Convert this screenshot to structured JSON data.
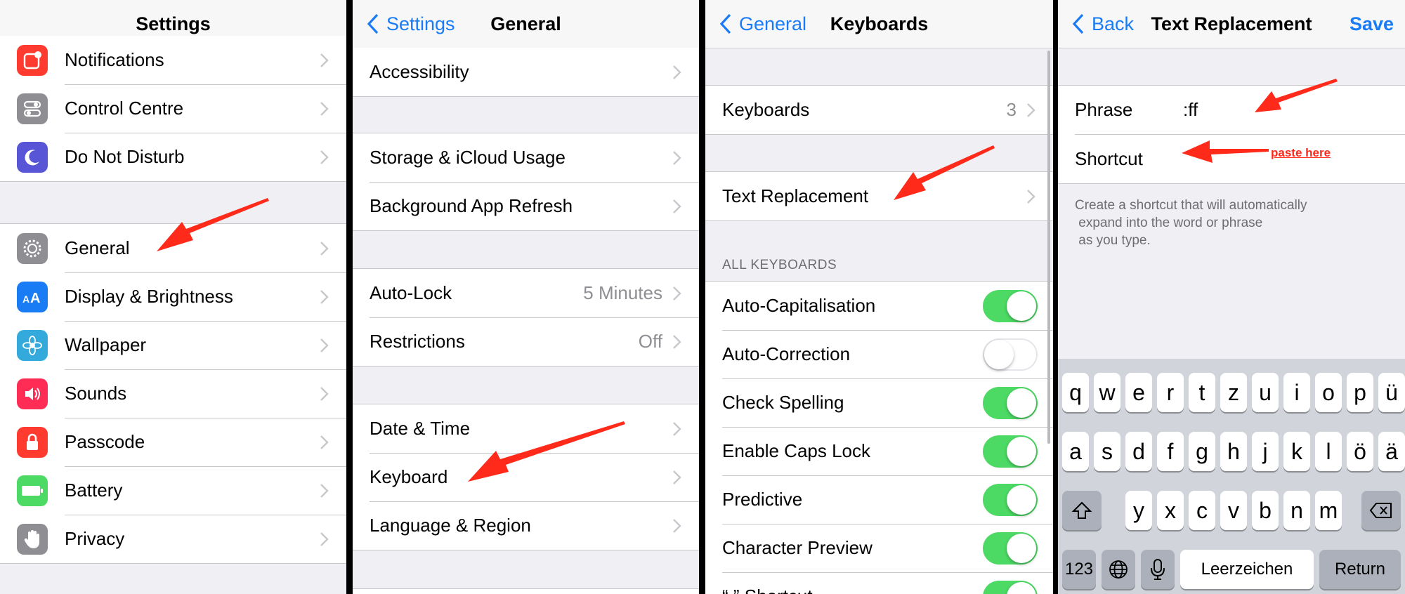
{
  "panel1": {
    "title": "Settings",
    "rows_top": [
      {
        "label": "Notifications",
        "icon": "notifications-icon",
        "color": "#ff3b30"
      },
      {
        "label": "Control Centre",
        "icon": "control-centre-icon",
        "color": "#8e8e93"
      },
      {
        "label": "Do Not Disturb",
        "icon": "moon-icon",
        "color": "#5856d6"
      }
    ],
    "rows_bottom": [
      {
        "label": "General",
        "icon": "gear-icon",
        "color": "#8e8e93"
      },
      {
        "label": "Display & Brightness",
        "icon": "text-size-icon",
        "color": "#1a7cf5"
      },
      {
        "label": "Wallpaper",
        "icon": "flower-icon",
        "color": "#34aadc"
      },
      {
        "label": "Sounds",
        "icon": "speaker-icon",
        "color": "#ff2d55"
      },
      {
        "label": "Passcode",
        "icon": "lock-icon",
        "color": "#ff3b30"
      },
      {
        "label": "Battery",
        "icon": "battery-icon",
        "color": "#4cd964"
      },
      {
        "label": "Privacy",
        "icon": "hand-icon",
        "color": "#8e8e93"
      }
    ]
  },
  "panel2": {
    "back": "Settings",
    "title": "General",
    "group1": [
      {
        "label": "Accessibility"
      }
    ],
    "group2": [
      {
        "label": "Storage & iCloud Usage"
      },
      {
        "label": "Background App Refresh"
      }
    ],
    "group3": [
      {
        "label": "Auto-Lock",
        "value": "5 Minutes"
      },
      {
        "label": "Restrictions",
        "value": "Off"
      }
    ],
    "group4": [
      {
        "label": "Date & Time"
      },
      {
        "label": "Keyboard"
      },
      {
        "label": "Language & Region"
      }
    ]
  },
  "panel3": {
    "back": "General",
    "title": "Keyboards",
    "keyboards": {
      "label": "Keyboards",
      "value": "3"
    },
    "text_replacement": "Text Replacement",
    "section_header": "ALL KEYBOARDS",
    "toggles": [
      {
        "label": "Auto-Capitalisation",
        "on": true
      },
      {
        "label": "Auto-Correction",
        "on": false
      },
      {
        "label": "Check Spelling",
        "on": true
      },
      {
        "label": "Enable Caps Lock",
        "on": true
      },
      {
        "label": "Predictive",
        "on": true
      },
      {
        "label": "Character Preview",
        "on": true
      },
      {
        "label": "“.” Shortcut",
        "on": true
      }
    ]
  },
  "panel4": {
    "back": "Back",
    "title": "Text Replacement",
    "save": "Save",
    "phrase_label": "Phrase",
    "phrase_value": ":ff",
    "shortcut_label": "Shortcut",
    "shortcut_value": "",
    "paste_note": "paste here",
    "hint_lines": [
      "Create a shortcut that will automatically",
      " expand into the word or phrase",
      " as you type."
    ],
    "keyboard": {
      "row1": [
        "q",
        "w",
        "e",
        "r",
        "t",
        "z",
        "u",
        "i",
        "o",
        "p",
        "ü"
      ],
      "row2": [
        "a",
        "s",
        "d",
        "f",
        "g",
        "h",
        "j",
        "k",
        "l",
        "ö",
        "ä"
      ],
      "row3": [
        "y",
        "x",
        "c",
        "v",
        "b",
        "n",
        "m"
      ],
      "numbers": "123",
      "space": "Leerzeichen",
      "return": "Return"
    }
  },
  "accent": "#1a7cf5",
  "annotation_color": "#ff2a1a"
}
